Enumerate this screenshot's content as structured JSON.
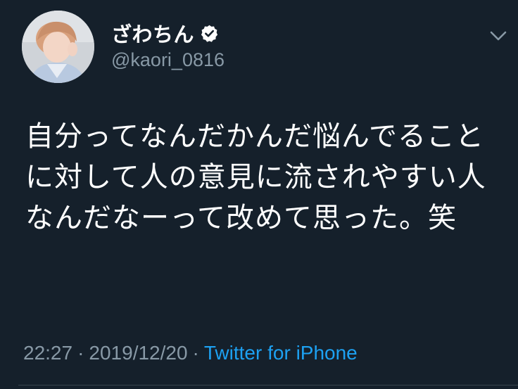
{
  "user": {
    "display_name": "ざわちん",
    "handle": "@kaori_0816",
    "verified": true,
    "avatar_icon": "user-avatar"
  },
  "tweet": {
    "text": "自分ってなんだかんだ悩んでることに対して人の意見に流されやすい人なんだなーって改めて思った。笑",
    "time": "22:27",
    "separator": "·",
    "date": "2019/12/20",
    "source": "Twitter for iPhone"
  },
  "menu": {
    "icon": "chevron-down-icon"
  },
  "colors": {
    "background": "#15202b",
    "text": "#ffffff",
    "secondary_text": "#8899a6",
    "link": "#1da1f2",
    "divider": "#38444d"
  }
}
